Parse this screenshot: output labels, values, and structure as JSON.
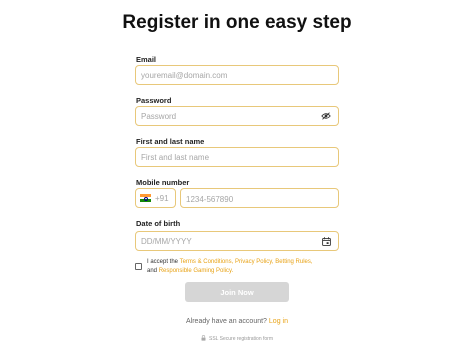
{
  "title": "Register in one easy step",
  "email": {
    "label": "Email",
    "placeholder": "youremail@domain.com"
  },
  "password": {
    "label": "Password",
    "placeholder": "Password",
    "toggle_icon": "eye-slash-icon"
  },
  "name": {
    "label": "First and last name",
    "placeholder": "First and last name"
  },
  "mobile": {
    "label": "Mobile number",
    "flag": "india-flag",
    "code": "+91",
    "placeholder": "1234-567890"
  },
  "dob": {
    "label": "Date of birth",
    "placeholder": "DD/MM/YYYY",
    "icon": "calendar-icon"
  },
  "terms": {
    "prefix": "I accept the ",
    "link_terms": "Terms & Conditions,",
    "link_privacy": "Privacy Policy,",
    "link_betting": "Betting Rules,",
    "and": "and",
    "link_responsible": "Responsible Gaming Policy.",
    "checked": false
  },
  "join_button": "Join Now",
  "login": {
    "prompt": "Already have an account?",
    "link": "Log in"
  },
  "secure_text": "SSL Secure registration form",
  "colors": {
    "accent": "#e8a317",
    "field_border": "#e8c87a",
    "button_disabled": "#d6d6d6"
  }
}
